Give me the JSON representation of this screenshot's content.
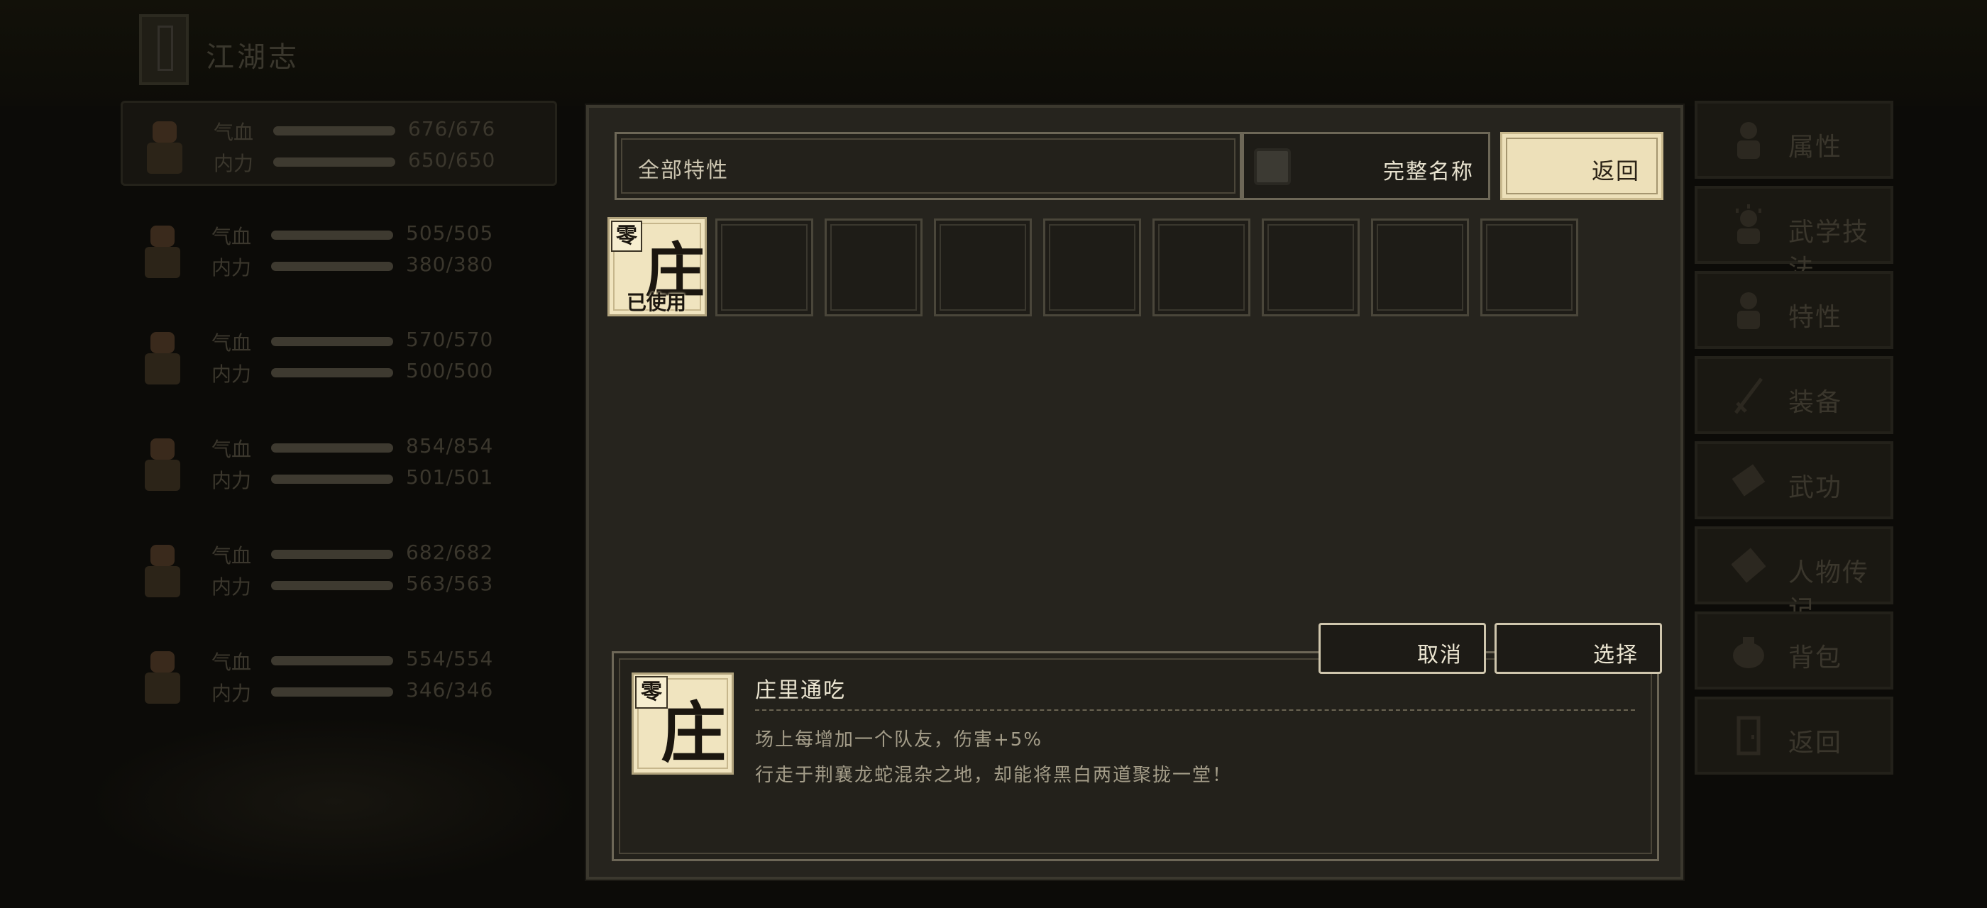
{
  "top_bar": {
    "title": "江湖志"
  },
  "characters": [
    {
      "hp_label": "气血",
      "hp": "676/676",
      "mp_label": "内力",
      "mp": "650/650"
    },
    {
      "hp_label": "气血",
      "hp": "505/505",
      "mp_label": "内力",
      "mp": "380/380"
    },
    {
      "hp_label": "气血",
      "hp": "570/570",
      "mp_label": "内力",
      "mp": "500/500"
    },
    {
      "hp_label": "气血",
      "hp": "854/854",
      "mp_label": "内力",
      "mp": "501/501"
    },
    {
      "hp_label": "气血",
      "hp": "682/682",
      "mp_label": "内力",
      "mp": "563/563"
    },
    {
      "hp_label": "气血",
      "hp": "554/554",
      "mp_label": "内力",
      "mp": "346/346"
    }
  ],
  "side_menu": [
    {
      "label": "属性",
      "icon": "person-icon"
    },
    {
      "label": "武学技法",
      "icon": "person-spark-icon"
    },
    {
      "label": "特性",
      "icon": "person-trait-icon"
    },
    {
      "label": "装备",
      "icon": "sword-icon"
    },
    {
      "label": "武功",
      "icon": "scroll-icon"
    },
    {
      "label": "人物传记",
      "icon": "book-icon"
    },
    {
      "label": "背包",
      "icon": "bag-icon"
    },
    {
      "label": "返回",
      "icon": "door-icon"
    }
  ],
  "modal": {
    "filter": "全部特性",
    "toggle_label": "完整名称",
    "back_label": "返回",
    "cancel_label": "取消",
    "select_label": "选择",
    "selected_trait": {
      "tag": "零",
      "char": "庄",
      "used_label": "已使用"
    },
    "detail": {
      "tag": "零",
      "char": "庄",
      "name": "庄里通吃",
      "effect": "场上每增加一个队友，伤害+5%",
      "description": "行走于荆襄龙蛇混杂之地，却能将黑白两道聚拢一堂！"
    }
  },
  "colors": {
    "card_bg": "#f0e4bf",
    "button_light": "#ede0b9",
    "modal_bg": "#26241e"
  }
}
